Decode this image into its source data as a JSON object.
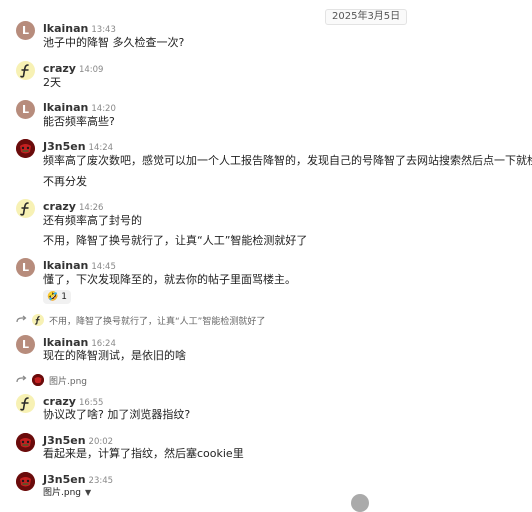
{
  "date_badge": "2025年3月5日",
  "messages": [
    {
      "author": "lkainan",
      "time": "13:43",
      "lines": [
        "池子中的降智 多久检查一次?"
      ]
    },
    {
      "author": "crazy",
      "time": "14:09",
      "lines": [
        "2天"
      ]
    },
    {
      "author": "lkainan",
      "time": "14:20",
      "lines": [
        "能否频率高些?"
      ]
    },
    {
      "author": "J3n5en",
      "time": "14:24",
      "lines": [
        "频率高了废次数吧，感觉可以加一个人工报告降智的，发现自己的号降智了去网站搜索然后点一下就检测",
        "不再分发"
      ]
    },
    {
      "author": "crazy",
      "time": "14:26",
      "lines": [
        "还有频率高了封号的",
        "不用，降智了换号就行了，让真“人工”智能检测就好了"
      ]
    },
    {
      "author": "lkainan",
      "time": "14:45",
      "lines": [
        "懂了，下次发现降至的，就去你的帖子里面骂楼主。"
      ],
      "reaction": {
        "emoji": "🤣",
        "count": "1"
      }
    },
    {
      "author": "lkainan",
      "time": "16:24",
      "lines": [
        "现在的降智测试，是依旧的啥"
      ]
    },
    {
      "author": "crazy",
      "time": "16:55",
      "lines": [
        "协议改了啥? 加了浏览器指纹?"
      ]
    },
    {
      "author": "J3n5en",
      "time": "20:02",
      "lines": [
        "看起来是，计算了指纹，然后塞cookie里"
      ]
    },
    {
      "author": "J3n5en",
      "time": "23:45",
      "lines": [
        "图片.png"
      ]
    }
  ],
  "replies": [
    {
      "text": "不用，降智了换号就行了，让真“人工”智能检测就好了"
    },
    {
      "text": "图片.png"
    }
  ],
  "avatars": {
    "lkainan_letter": "L"
  },
  "icons": {
    "reply": "reply-arrow-icon",
    "crazy_avatar": "crazy-f-logo",
    "j3n5en_avatar": "red-mask-avatar",
    "caret": "caret-down-icon"
  },
  "colors": {
    "lkainan_avatar": "#b78c7c",
    "crazy_avatar": "#f7f1b4",
    "j3n5en_avatar": "#7a1010"
  }
}
